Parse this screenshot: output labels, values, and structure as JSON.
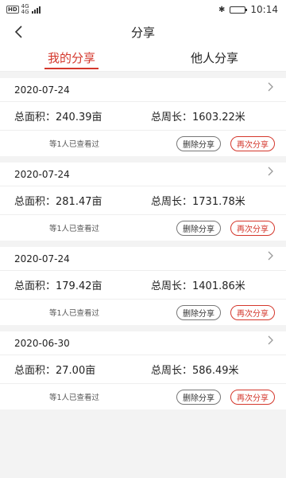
{
  "status_bar": {
    "left_badge": "HD",
    "net_top": "4G",
    "net_bottom": "4G",
    "time": "10:14",
    "battery_level": 0.95
  },
  "header": {
    "title": "分享"
  },
  "tabs": [
    {
      "label": "我的分享",
      "active": true
    },
    {
      "label": "他人分享",
      "active": false
    }
  ],
  "shares": [
    {
      "date": "2020-07-24",
      "area": "总面积：240.39亩",
      "perimeter": "总周长：1603.22米",
      "viewed": "等1人已查看过",
      "delete_label": "删除分享",
      "reshare_label": "再次分享"
    },
    {
      "date": "2020-07-24",
      "area": "总面积：281.47亩",
      "perimeter": "总周长：1731.78米",
      "viewed": "等1人已查看过",
      "delete_label": "删除分享",
      "reshare_label": "再次分享"
    },
    {
      "date": "2020-07-24",
      "area": "总面积：179.42亩",
      "perimeter": "总周长：1401.86米",
      "viewed": "等1人已查看过",
      "delete_label": "删除分享",
      "reshare_label": "再次分享"
    },
    {
      "date": "2020-06-30",
      "area": "总面积：27.00亩",
      "perimeter": "总周长：586.49米",
      "viewed": "等1人已查看过",
      "delete_label": "删除分享",
      "reshare_label": "再次分享"
    }
  ],
  "colors": {
    "accent": "#d4372c",
    "background": "#f3f3f3"
  }
}
